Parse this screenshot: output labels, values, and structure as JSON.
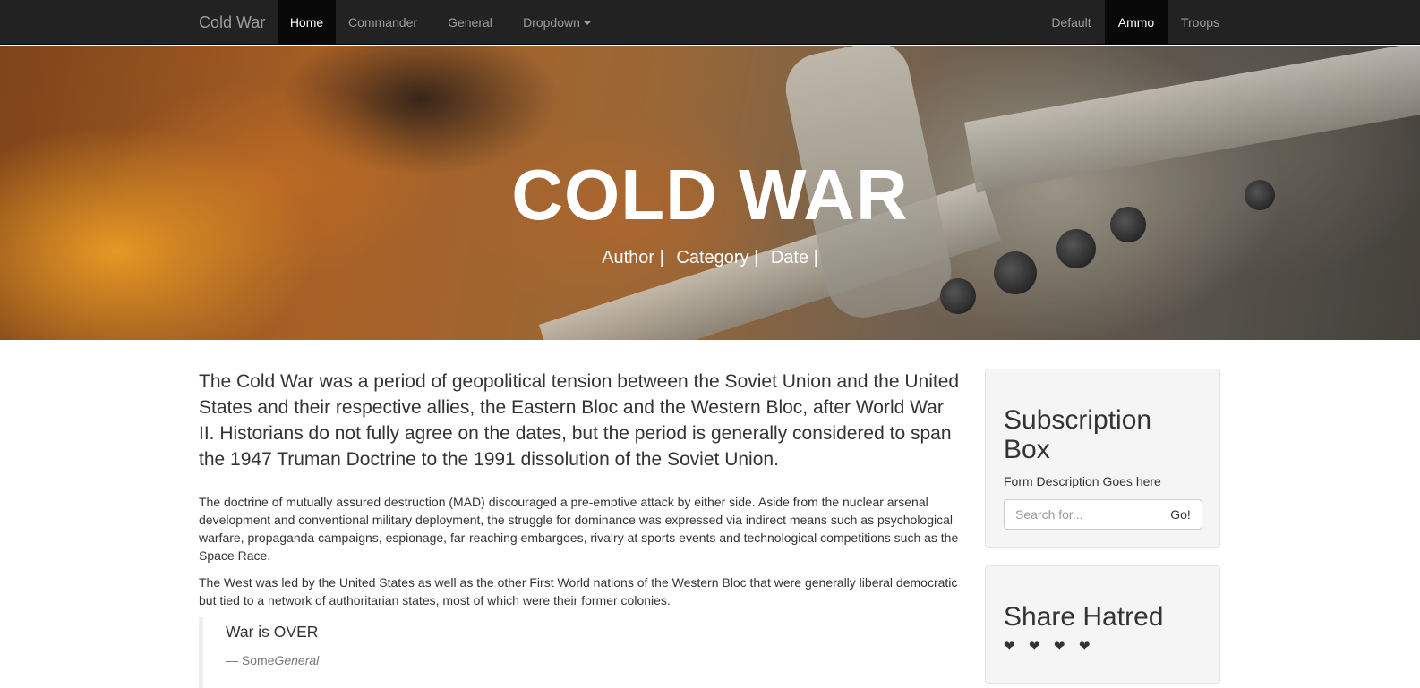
{
  "navbar": {
    "brand": "Cold War",
    "left_items": [
      "Home",
      "Commander",
      "General",
      "Dropdown"
    ],
    "right_items": [
      "Default",
      "Ammo",
      "Troops"
    ],
    "active_left": "Home",
    "active_right": "Ammo"
  },
  "hero": {
    "title": "COLD WAR",
    "meta": [
      "Author |",
      "Category |",
      "Date |"
    ]
  },
  "article": {
    "lead": "The Cold War was a period of geopolitical tension between the Soviet Union and the United States and their respective allies, the Eastern Bloc and the Western Bloc, after World War II. Historians do not fully agree on the dates, but the period is generally considered to span the 1947 Truman Doctrine to the 1991 dissolution of the Soviet Union.",
    "paragraphs": [
      "The doctrine of mutually assured destruction (MAD) discouraged a pre-emptive attack by either side. Aside from the nuclear arsenal development and conventional military deployment, the struggle for dominance was expressed via indirect means such as psychological warfare, propaganda campaigns, espionage, far-reaching embargoes, rivalry at sports events and technological competitions such as the Space Race.",
      "The West was led by the United States as well as the other First World nations of the Western Bloc that were generally liberal democratic but tied to a network of authoritarian states, most of which were their former colonies."
    ],
    "quote": {
      "text": "War is OVER",
      "footer_prefix": "— Some",
      "footer_cite": "General"
    }
  },
  "sidebar": {
    "subscription": {
      "title": "Subscription Box",
      "description": "Form Description Goes here",
      "placeholder": "Search for...",
      "button": "Go!"
    },
    "share": {
      "title": "Share Hatred",
      "icons": [
        "heart-icon",
        "heart-icon",
        "heart-icon",
        "heart-icon"
      ],
      "glyph": "❤"
    }
  }
}
